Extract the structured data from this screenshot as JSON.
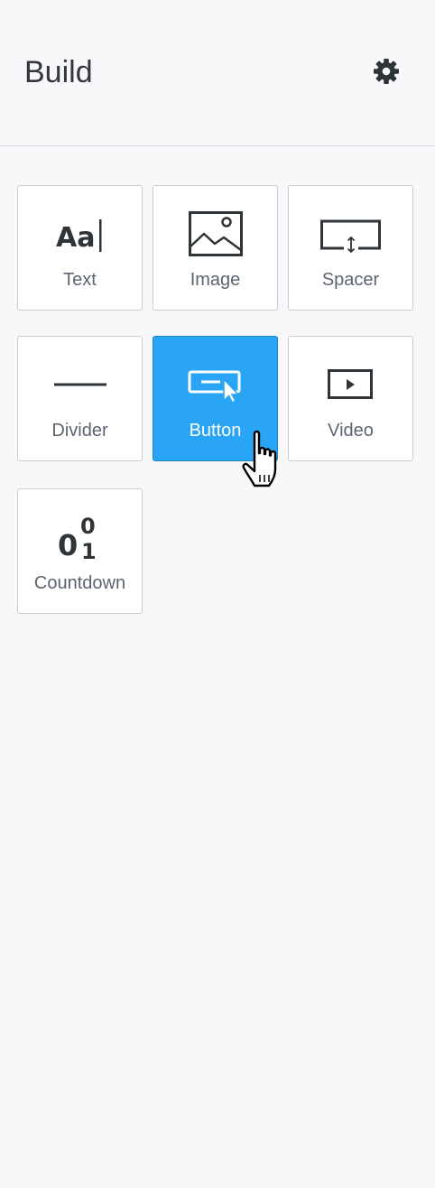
{
  "header": {
    "title": "Build",
    "settings_icon": "gear-icon"
  },
  "tiles": [
    {
      "label": "Text",
      "icon": "text-format-icon",
      "icon_text": "Aa"
    },
    {
      "label": "Image",
      "icon": "image-icon"
    },
    {
      "label": "Spacer",
      "icon": "spacer-icon"
    },
    {
      "label": "Divider",
      "icon": "divider-icon"
    },
    {
      "label": "Button",
      "icon": "button-icon",
      "state": "hover"
    },
    {
      "label": "Video",
      "icon": "video-icon"
    },
    {
      "label": "Countdown",
      "icon": "countdown-icon",
      "icon_text": [
        "0",
        "0",
        "1"
      ]
    }
  ],
  "colors": {
    "background": "#f8f8fb",
    "accent": "#2aa4f4",
    "tile_border": "#c9ccd1",
    "label": "#5b6470",
    "icon": "#2f3438"
  },
  "cursor": "hand-pointer-icon"
}
